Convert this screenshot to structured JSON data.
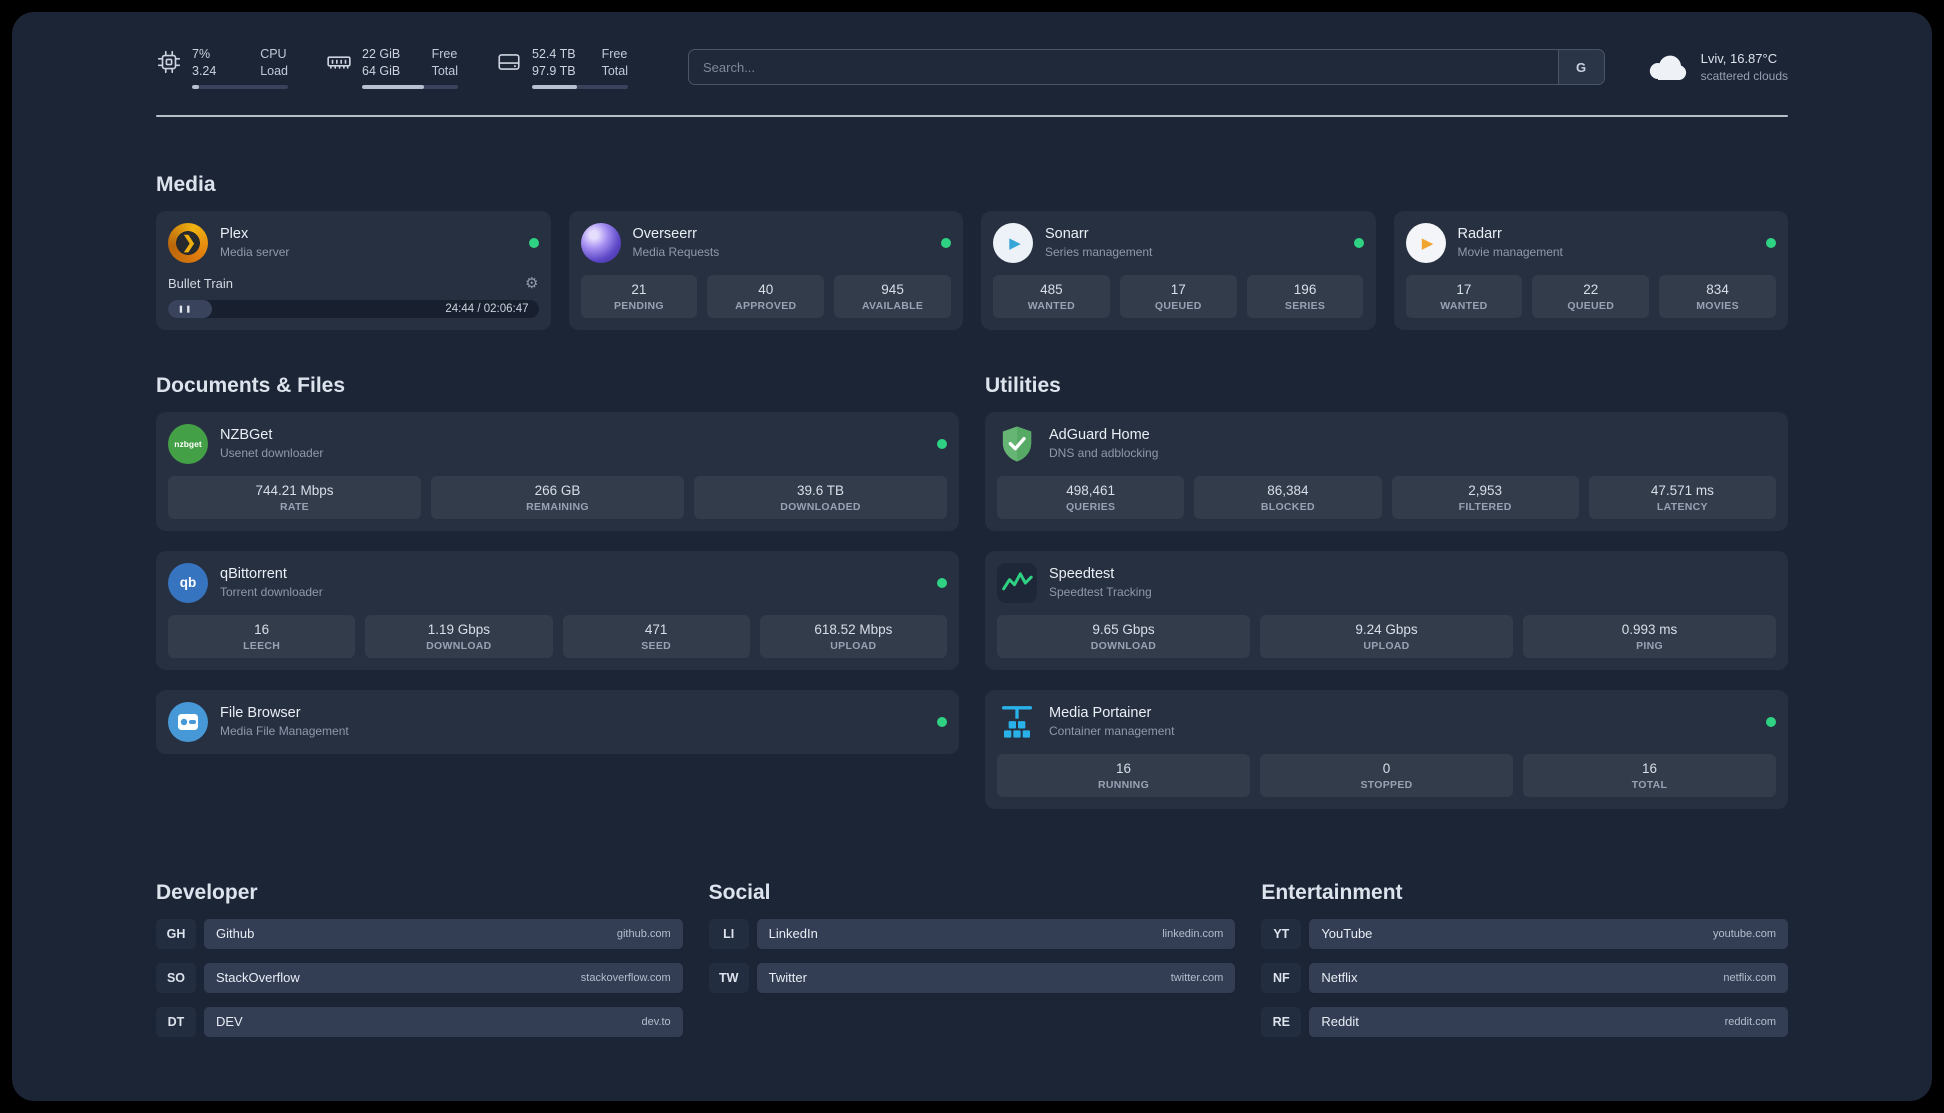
{
  "topbar": {
    "cpu": {
      "percent": "7%",
      "load": "3.24",
      "label_top": "CPU",
      "label_bottom": "Load"
    },
    "memory": {
      "free": "22 GiB",
      "free_label": "Free",
      "total": "64 GiB",
      "total_label": "Total"
    },
    "disk": {
      "free": "52.4 TB",
      "free_label": "Free",
      "total": "97.9 TB",
      "total_label": "Total"
    },
    "search": {
      "placeholder": "Search...",
      "button": "G"
    },
    "weather": {
      "location": "Lviv, 16.87°C",
      "condition": "scattered clouds"
    }
  },
  "icons": {
    "gear": "⚙",
    "pause": "❚❚",
    "plex_chevron": "❯",
    "play": "▶",
    "nzbget_text": "nzbget",
    "qbittorrent_text": "qb"
  },
  "media": {
    "title": "Media",
    "plex": {
      "name": "Plex",
      "subtitle": "Media server",
      "now_playing": "Bullet Train",
      "time": "24:44 / 02:06:47"
    },
    "overseerr": {
      "name": "Overseerr",
      "subtitle": "Media Requests",
      "stats": [
        {
          "value": "21",
          "label": "PENDING"
        },
        {
          "value": "40",
          "label": "APPROVED"
        },
        {
          "value": "945",
          "label": "AVAILABLE"
        }
      ]
    },
    "sonarr": {
      "name": "Sonarr",
      "subtitle": "Series management",
      "stats": [
        {
          "value": "485",
          "label": "WANTED"
        },
        {
          "value": "17",
          "label": "QUEUED"
        },
        {
          "value": "196",
          "label": "SERIES"
        }
      ]
    },
    "radarr": {
      "name": "Radarr",
      "subtitle": "Movie management",
      "stats": [
        {
          "value": "17",
          "label": "WANTED"
        },
        {
          "value": "22",
          "label": "QUEUED"
        },
        {
          "value": "834",
          "label": "MOVIES"
        }
      ]
    }
  },
  "documents": {
    "title": "Documents & Files",
    "nzbget": {
      "name": "NZBGet",
      "subtitle": "Usenet downloader",
      "stats": [
        {
          "value": "744.21 Mbps",
          "label": "RATE"
        },
        {
          "value": "266 GB",
          "label": "REMAINING"
        },
        {
          "value": "39.6 TB",
          "label": "DOWNLOADED"
        }
      ]
    },
    "qbittorrent": {
      "name": "qBittorrent",
      "subtitle": "Torrent downloader",
      "stats": [
        {
          "value": "16",
          "label": "LEECH"
        },
        {
          "value": "1.19 Gbps",
          "label": "DOWNLOAD"
        },
        {
          "value": "471",
          "label": "SEED"
        },
        {
          "value": "618.52 Mbps",
          "label": "UPLOAD"
        }
      ]
    },
    "filebrowser": {
      "name": "File Browser",
      "subtitle": "Media File Management"
    }
  },
  "utilities": {
    "title": "Utilities",
    "adguard": {
      "name": "AdGuard Home",
      "subtitle": "DNS and adblocking",
      "stats": [
        {
          "value": "498,461",
          "label": "QUERIES"
        },
        {
          "value": "86,384",
          "label": "BLOCKED"
        },
        {
          "value": "2,953",
          "label": "FILTERED"
        },
        {
          "value": "47.571 ms",
          "label": "LATENCY"
        }
      ]
    },
    "speedtest": {
      "name": "Speedtest",
      "subtitle": "Speedtest Tracking",
      "stats": [
        {
          "value": "9.65 Gbps",
          "label": "DOWNLOAD"
        },
        {
          "value": "9.24 Gbps",
          "label": "UPLOAD"
        },
        {
          "value": "0.993 ms",
          "label": "PING"
        }
      ]
    },
    "portainer": {
      "name": "Media Portainer",
      "subtitle": "Container management",
      "stats": [
        {
          "value": "16",
          "label": "RUNNING"
        },
        {
          "value": "0",
          "label": "STOPPED"
        },
        {
          "value": "16",
          "label": "TOTAL"
        }
      ]
    }
  },
  "bookmarks": [
    {
      "title": "Developer",
      "items": [
        {
          "abbr": "GH",
          "name": "Github",
          "domain": "github.com"
        },
        {
          "abbr": "SO",
          "name": "StackOverflow",
          "domain": "stackoverflow.com"
        },
        {
          "abbr": "DT",
          "name": "DEV",
          "domain": "dev.to"
        }
      ]
    },
    {
      "title": "Social",
      "items": [
        {
          "abbr": "LI",
          "name": "LinkedIn",
          "domain": "linkedin.com"
        },
        {
          "abbr": "TW",
          "name": "Twitter",
          "domain": "twitter.com"
        }
      ]
    },
    {
      "title": "Entertainment",
      "items": [
        {
          "abbr": "YT",
          "name": "YouTube",
          "domain": "youtube.com"
        },
        {
          "abbr": "NF",
          "name": "Netflix",
          "domain": "netflix.com"
        },
        {
          "abbr": "RE",
          "name": "Reddit",
          "domain": "reddit.com"
        }
      ]
    }
  ]
}
